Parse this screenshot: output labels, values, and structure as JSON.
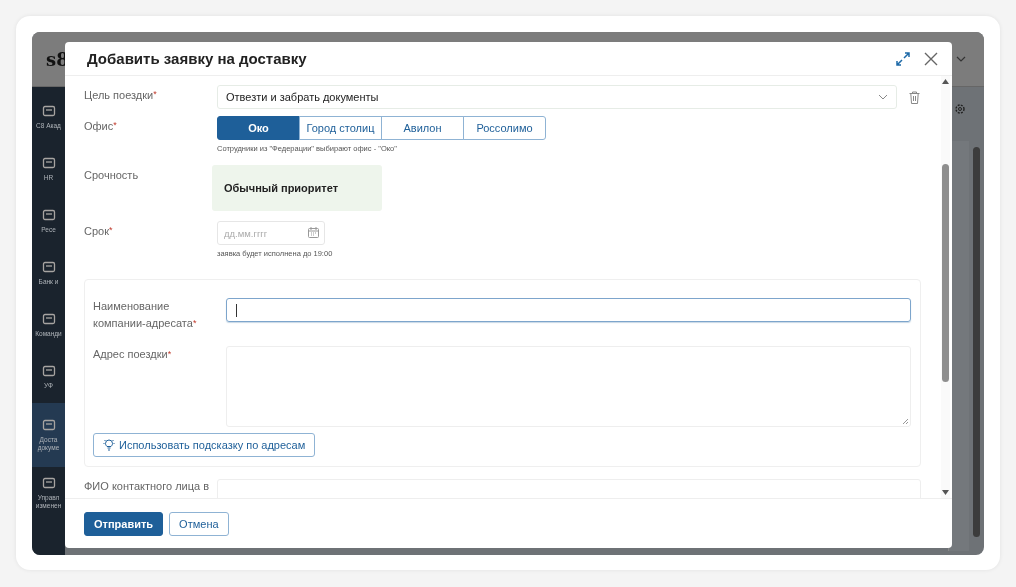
{
  "app": {
    "logo": "s8",
    "sidebar": [
      {
        "label": "С8 Акад",
        "selected": false
      },
      {
        "label": "HR",
        "selected": false
      },
      {
        "label": "Ресе",
        "selected": false
      },
      {
        "label": "Банк и",
        "selected": false
      },
      {
        "label": "Команди",
        "selected": false
      },
      {
        "label": "УФ",
        "selected": false
      },
      {
        "label": "Доста докуме",
        "selected": true
      },
      {
        "label": "Управл изменен",
        "selected": false
      }
    ]
  },
  "dialog": {
    "title": "Добавить заявку на доставку",
    "fields": [
      {
        "kind": "select",
        "label": "Цель поездки",
        "asterisk": "*",
        "value": "Отвезти и забрать документы"
      },
      {
        "kind": "segmented",
        "label": "Офис",
        "asterisk": "*",
        "options": [
          {
            "label": "Око",
            "selected": true
          },
          {
            "label": "Город столиц",
            "selected": false
          },
          {
            "label": "Авилон",
            "selected": false
          },
          {
            "label": "Россолимо",
            "selected": false
          }
        ],
        "hint": "Сотрудники из \"Федерации\" выбирают офис - \"Око\""
      },
      {
        "kind": "priority",
        "label": "Срочность",
        "value": "Обычный приоритет",
        "color": "#eef5ec"
      },
      {
        "kind": "date",
        "label": "Срок",
        "asterisk": "*",
        "placeholder": "дд.мм.гггг",
        "hint": "заявка будет исполнена до 19:00"
      },
      {
        "kind": "group",
        "fields": [
          {
            "kind": "input",
            "label": "Наименование компании-адресата",
            "asterisk": "*",
            "focused": true
          },
          {
            "kind": "textarea",
            "label": "Адрес поездки",
            "asterisk": "*"
          }
        ],
        "button": "Использовать подсказку по адресам"
      },
      {
        "kind": "input",
        "label": "ФИО контактного лица в"
      }
    ],
    "buttons": [
      {
        "label": "Отправить",
        "kind": "primary"
      },
      {
        "label": "Отмена",
        "kind": "secondary"
      }
    ]
  }
}
